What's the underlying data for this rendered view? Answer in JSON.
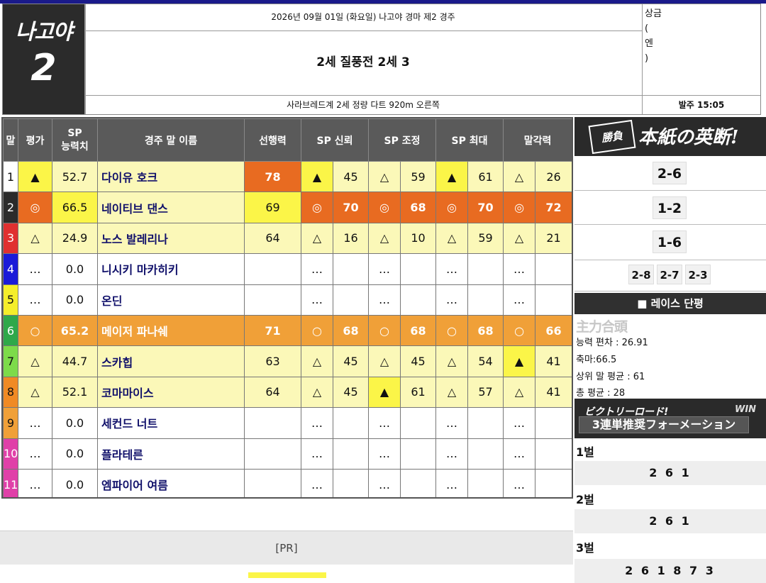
{
  "header": {
    "venue": "나고야",
    "race_no": "2",
    "date_line": "2026년 09월 01일 (화요일) 나고야 경마 제2 경주",
    "title": "2세 질풍전 2세 3",
    "sub_line": "사라브레드계 2세 정량 다트 920m 오른쪽",
    "prize_label_1": "상금",
    "prize_label_2": "(",
    "prize_label_3": "엔",
    "prize_label_4": ")",
    "post_time": "발주 15:05"
  },
  "table": {
    "headers": [
      "말",
      "평가",
      "SP\n능력치",
      "경주 말 이름",
      "선행력",
      "SP 신뢰",
      "SP 조정",
      "SP 최대",
      "말각력"
    ],
    "rows": [
      {
        "num": "1",
        "numcolor": "#ffffff",
        "numtext": "#111111",
        "eval": "▲",
        "sp": "52.7",
        "name": "다이유 호크",
        "lead": "78",
        "s1": "▲",
        "v1": "45",
        "s2": "△",
        "v2": "59",
        "s3": "▲",
        "v3": "61",
        "s4": "△",
        "v4": "26",
        "c": [
          "yel",
          "lyel",
          "lyel",
          "dark",
          "yel",
          "lyel",
          "lyel",
          "lyel",
          "yel",
          "lyel",
          "lyel",
          "lyel"
        ]
      },
      {
        "num": "2",
        "numcolor": "#2b2b2b",
        "numtext": "#ffffff",
        "eval": "◎",
        "sp": "66.5",
        "name": "네이티브 댄스",
        "lead": "69",
        "s1": "◎",
        "v1": "70",
        "s2": "◎",
        "v2": "68",
        "s3": "◎",
        "v3": "70",
        "s4": "◎",
        "v4": "72",
        "c": [
          "dark",
          "yel",
          "lyel",
          "yel",
          "dark",
          "dark",
          "dark",
          "dark",
          "dark",
          "dark",
          "dark",
          "dark"
        ]
      },
      {
        "num": "3",
        "numcolor": "#e03030",
        "numtext": "#ffffff",
        "eval": "△",
        "sp": "24.9",
        "name": "노스 발레리나",
        "lead": "64",
        "s1": "△",
        "v1": "16",
        "s2": "△",
        "v2": "10",
        "s3": "△",
        "v3": "59",
        "s4": "△",
        "v4": "21",
        "c": [
          "lyel",
          "lyel",
          "lyel",
          "lyel",
          "lyel",
          "lyel",
          "lyel",
          "lyel",
          "lyel",
          "lyel",
          "lyel",
          "lyel"
        ]
      },
      {
        "num": "4",
        "numcolor": "#1a1ad8",
        "numtext": "#ffffff",
        "eval": "…",
        "sp": "0.0",
        "name": "니시키 마카히키",
        "lead": "",
        "s1": "…",
        "v1": "",
        "s2": "…",
        "v2": "",
        "s3": "…",
        "v3": "",
        "s4": "…",
        "v4": "",
        "c": [
          "wht",
          "wht",
          "wht",
          "wht",
          "wht",
          "wht",
          "wht",
          "wht",
          "wht",
          "wht",
          "wht",
          "wht"
        ]
      },
      {
        "num": "5",
        "numcolor": "#f5ee2a",
        "numtext": "#111111",
        "eval": "…",
        "sp": "0.0",
        "name": "온딘",
        "lead": "",
        "s1": "…",
        "v1": "",
        "s2": "…",
        "v2": "",
        "s3": "…",
        "v3": "",
        "s4": "…",
        "v4": "",
        "c": [
          "wht",
          "wht",
          "wht",
          "wht",
          "wht",
          "wht",
          "wht",
          "wht",
          "wht",
          "wht",
          "wht",
          "wht"
        ]
      },
      {
        "num": "6",
        "numcolor": "#2fa84a",
        "numtext": "#ffffff",
        "eval": "○",
        "sp": "65.2",
        "name": "메이저 파나쉐",
        "lead": "71",
        "s1": "○",
        "v1": "68",
        "s2": "○",
        "v2": "68",
        "s3": "○",
        "v3": "68",
        "s4": "○",
        "v4": "66",
        "c": [
          "org",
          "org",
          "org",
          "org",
          "org",
          "org",
          "org",
          "org",
          "org",
          "org",
          "org",
          "org"
        ]
      },
      {
        "num": "7",
        "numcolor": "#7ddb4a",
        "numtext": "#111111",
        "eval": "△",
        "sp": "44.7",
        "name": "스카힙",
        "lead": "63",
        "s1": "△",
        "v1": "45",
        "s2": "△",
        "v2": "45",
        "s3": "△",
        "v3": "54",
        "s4": "▲",
        "v4": "41",
        "c": [
          "lyel",
          "lyel",
          "lyel",
          "lyel",
          "lyel",
          "lyel",
          "lyel",
          "lyel",
          "lyel",
          "lyel",
          "yel",
          "lyel"
        ]
      },
      {
        "num": "8",
        "numcolor": "#f08a24",
        "numtext": "#111111",
        "eval": "△",
        "sp": "52.1",
        "name": "코마마이스",
        "lead": "64",
        "s1": "△",
        "v1": "45",
        "s2": "▲",
        "v2": "61",
        "s3": "△",
        "v3": "57",
        "s4": "△",
        "v4": "41",
        "c": [
          "lyel",
          "lyel",
          "lyel",
          "lyel",
          "lyel",
          "lyel",
          "yel",
          "lyel",
          "lyel",
          "lyel",
          "lyel",
          "lyel"
        ]
      },
      {
        "num": "9",
        "numcolor": "#f0a038",
        "numtext": "#111111",
        "eval": "…",
        "sp": "0.0",
        "name": "세컨드 너트",
        "lead": "",
        "s1": "…",
        "v1": "",
        "s2": "…",
        "v2": "",
        "s3": "…",
        "v3": "",
        "s4": "…",
        "v4": "",
        "c": [
          "wht",
          "wht",
          "wht",
          "wht",
          "wht",
          "wht",
          "wht",
          "wht",
          "wht",
          "wht",
          "wht",
          "wht"
        ]
      },
      {
        "num": "10",
        "numcolor": "#e040a8",
        "numtext": "#ffffff",
        "eval": "…",
        "sp": "0.0",
        "name": "플라테른",
        "lead": "",
        "s1": "…",
        "v1": "",
        "s2": "…",
        "v2": "",
        "s3": "…",
        "v3": "",
        "s4": "…",
        "v4": "",
        "c": [
          "wht",
          "wht",
          "wht",
          "wht",
          "wht",
          "wht",
          "wht",
          "wht",
          "wht",
          "wht",
          "wht",
          "wht"
        ]
      },
      {
        "num": "11",
        "numcolor": "#e040a8",
        "numtext": "#ffffff",
        "eval": "…",
        "sp": "0.0",
        "name": "엠파이어 여름",
        "lead": "",
        "s1": "…",
        "v1": "",
        "s2": "…",
        "v2": "",
        "s3": "…",
        "v3": "",
        "s4": "…",
        "v4": "",
        "c": [
          "wht",
          "wht",
          "wht",
          "wht",
          "wht",
          "wht",
          "wht",
          "wht",
          "wht",
          "wht",
          "wht",
          "wht"
        ]
      }
    ]
  },
  "pr": {
    "label": "[PR]"
  },
  "side": {
    "banner1_icon": "勝負",
    "banner1_text": "本紙の英断!",
    "picks": [
      "2-6",
      "1-2",
      "1-6"
    ],
    "picks_small": [
      "2-8",
      "2-7",
      "2-3"
    ],
    "review_title": "■ 레이스 단평",
    "review_stamp": "主力合頭",
    "review_lines": [
      "능력 편차 : 26.91",
      "축마:66.5",
      "상위 말 평균 : 61",
      "총 평균 : 28"
    ],
    "banner2_line1": "ビクトリーロード!",
    "banner2_line2": "3連単推奨フォーメーション",
    "banner2_win": "WIN",
    "formation": [
      {
        "label": "1벌",
        "value": "2 6 1"
      },
      {
        "label": "2벌",
        "value": "2 6 1"
      },
      {
        "label": "3벌",
        "value": "2 6 1 8 7 3"
      }
    ]
  },
  "colors": {
    "dark": "#e86b21",
    "yellow": "#fbf548",
    "light_yellow": "#fbf8b8",
    "orange": "#f0a038",
    "header_gray": "#5a5a5a"
  }
}
